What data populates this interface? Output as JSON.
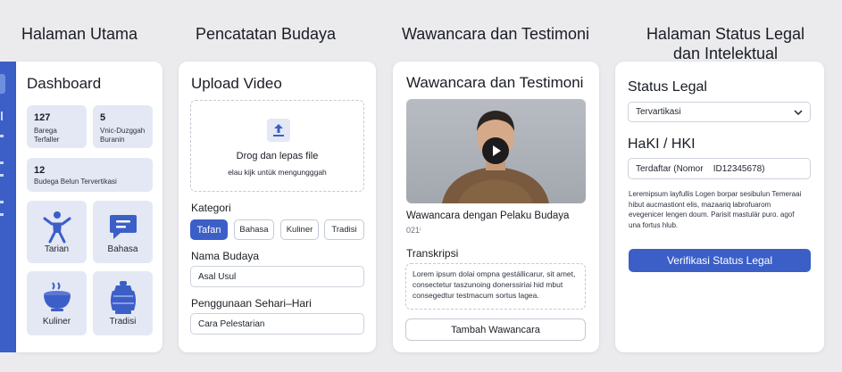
{
  "columns": {
    "col1_title": "Halaman Utama",
    "col2_title": "Pencatatan Budaya",
    "col3_title": "Wawancara dan Testimoni",
    "col4_title_line1": "Halaman Status Legal",
    "col4_title_line2": "dan Intelektual"
  },
  "dashboard": {
    "title": "Dashboard",
    "stats": [
      {
        "value": "127",
        "label_line1": "Barega",
        "label_line2": "Terfaller"
      },
      {
        "value": "5",
        "label_line1": "Vnic-Duzggah",
        "label_line2": "Buranin"
      }
    ],
    "wide_stat": {
      "value": "12",
      "label": "Budega Belun Tervertikasi"
    },
    "categories": [
      {
        "label": "Tarian",
        "icon": "dancer-icon"
      },
      {
        "label": "Bahasa",
        "icon": "speech-bubble-icon"
      },
      {
        "label": "Kuliner",
        "icon": "bowl-icon"
      },
      {
        "label": "Tradisi",
        "icon": "drum-icon"
      }
    ]
  },
  "upload": {
    "title": "Upload Video",
    "drop_main": "Drog dan lepas file",
    "drop_sub": "elau kijk untük mengungggah",
    "kategori_label": "Kategori",
    "chips": [
      "Tafan",
      "Bahasa",
      "Kuliner",
      "Tradisi"
    ],
    "nama_label": "Nama Budaya",
    "nama_value": "Asal Usul",
    "penggunaan_label": "Penggunaan Sehari–Hari",
    "penggunaan_value": "Cara Pelestarian"
  },
  "interview": {
    "title": "Wawancara dan Testimoni",
    "video_caption": "Wawancara dengan Pelaku Budaya",
    "video_meta": "021ⁱ",
    "transkripsi_label": "Transkripsi",
    "transcript": "Lorem ipsum dolai ompna gestállicarur, sit amet, consectetur taszunoing donerssiriai hid mbut consegedtur testmacum sortus lagea.",
    "add_button": "Tambah Wawancara"
  },
  "legal": {
    "status_label": "Status Legal",
    "status_value": "Tervartikasi",
    "haki_label": "HaKI / HKI",
    "haki_value": "Terdaftar (Nomor    ID12345678)",
    "description": "Leremipsum layfullis Logen borpar  sesibulun Temeraai hibut aucmastiont elis, mazaariq labrofuarom evegenicer lengen doum. Parisit mastulär puro. agof una fortus hlub.",
    "verify_button": "Verifikasi Status Legal"
  },
  "colors": {
    "accent": "#3b5fc7",
    "tile_bg": "#e3e8f4",
    "page_bg": "#ebebee"
  }
}
